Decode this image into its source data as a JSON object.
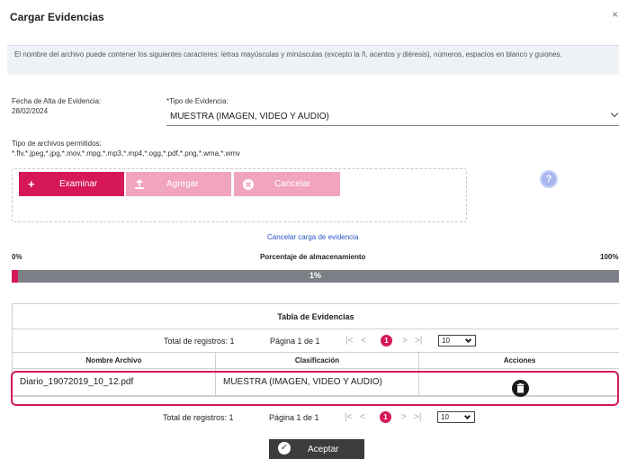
{
  "dialog": {
    "title": "Cargar Evidencias",
    "close": "×"
  },
  "info": {
    "text": "El nombre del archivo puede contener los siguientes caracteres: letras mayúsculas y minúsculas (excepto la ñ, acentos y diéresis), números, espacios en blanco y guiones."
  },
  "form": {
    "fecha_label": "Fecha de Alta de Evidencia:",
    "fecha_value": "28/02/2024",
    "tipo_label": "*Tipo de Evidencia:",
    "tipo_value": "MUESTRA (IMAGEN, VIDEO Y AUDIO)",
    "tipos_label": "Tipo de archivos permitidos:",
    "tipos_value": "*.flv,*.jpeg,*.jpg,*.mov,*.mpg,*.mp3,*.mp4,*.ogg,*.pdf,*.png,*.wma,*.wmv"
  },
  "upload": {
    "examinar": "Examinar",
    "agregar": "Agregar",
    "cancelar": "Cancelar",
    "help": "?",
    "cancel_link": "Cancelar carga de evidencia"
  },
  "storage": {
    "min": "0%",
    "max": "100%",
    "title": "Porcentaje de almacenamiento",
    "value_text": "1%",
    "fraction": 0.01
  },
  "table": {
    "title": "Tabla de Evidencias",
    "pager": {
      "total": "Total de registros: 1",
      "page": "Página 1 de 1",
      "current": "1",
      "first": "|<",
      "prev": "<",
      "next": ">",
      "last": ">|",
      "page_size": "10"
    },
    "columns": [
      "Nombre Archivo",
      "Clasificación",
      "Acciones"
    ],
    "rows": [
      {
        "nombre": "Diario_19072019_10_12.pdf",
        "clasificacion": "MUESTRA (IMAGEN, VIDEO Y AUDIO)"
      }
    ]
  },
  "footer": {
    "aceptar": "Aceptar"
  },
  "colors": {
    "accent": "#d6185a",
    "accent_light": "#f1a4bd",
    "bar_bg": "#7b8087",
    "dark_button": "#3c3c3c"
  }
}
